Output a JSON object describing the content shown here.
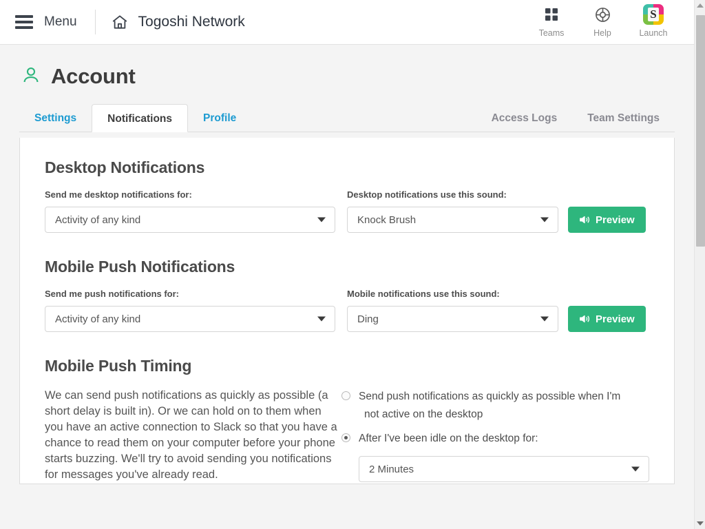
{
  "topbar": {
    "menu_label": "Menu",
    "brand_title": "Togoshi Network",
    "actions": [
      {
        "icon": "grid-icon",
        "label": "Teams"
      },
      {
        "icon": "lifebuoy-icon",
        "label": "Help"
      },
      {
        "icon": "slack-logo-icon",
        "label": "Launch"
      }
    ]
  },
  "page": {
    "title": "Account",
    "title_icon": "user-icon"
  },
  "tabs": {
    "left": [
      {
        "label": "Settings",
        "active": false,
        "style": "link"
      },
      {
        "label": "Notifications",
        "active": true,
        "style": "active"
      },
      {
        "label": "Profile",
        "active": false,
        "style": "link"
      }
    ],
    "right": [
      {
        "label": "Access Logs",
        "active": false,
        "style": "muted"
      },
      {
        "label": "Team Settings",
        "active": false,
        "style": "muted"
      }
    ]
  },
  "sections": {
    "desktop": {
      "heading": "Desktop Notifications",
      "left_label": "Send me desktop notifications for:",
      "left_value": "Activity of any kind",
      "right_label": "Desktop notifications use this sound:",
      "right_value": "Knock Brush",
      "preview_label": "Preview"
    },
    "mobile": {
      "heading": "Mobile Push Notifications",
      "left_label": "Send me push notifications for:",
      "left_value": "Activity of any kind",
      "right_label": "Mobile notifications use this sound:",
      "right_value": "Ding",
      "preview_label": "Preview"
    },
    "timing": {
      "heading": "Mobile Push Timing",
      "body": "We can send push notifications as quickly as possible (a short delay is built in). Or we can hold on to them when you have an active connection to Slack so that you have a chance to read them on your computer before your phone starts buzzing. We'll try to avoid sending you notifications for messages you've already read.",
      "option_immediate_line1": "Send push notifications as quickly as possible when I'm",
      "option_immediate_line2": "not active on the desktop",
      "option_immediate_selected": false,
      "option_idle_label": "After I've been idle on the desktop for:",
      "option_idle_selected": true,
      "idle_value": "2 Minutes"
    }
  },
  "colors": {
    "accent_green": "#2eb67d",
    "link_blue": "#1d9bd1",
    "page_bg": "#f4f4f4",
    "text_dark": "#3d3d3d"
  },
  "scrollbar": {
    "up_arrow": "scroll-up-arrow",
    "down_arrow": "scroll-down-arrow"
  }
}
